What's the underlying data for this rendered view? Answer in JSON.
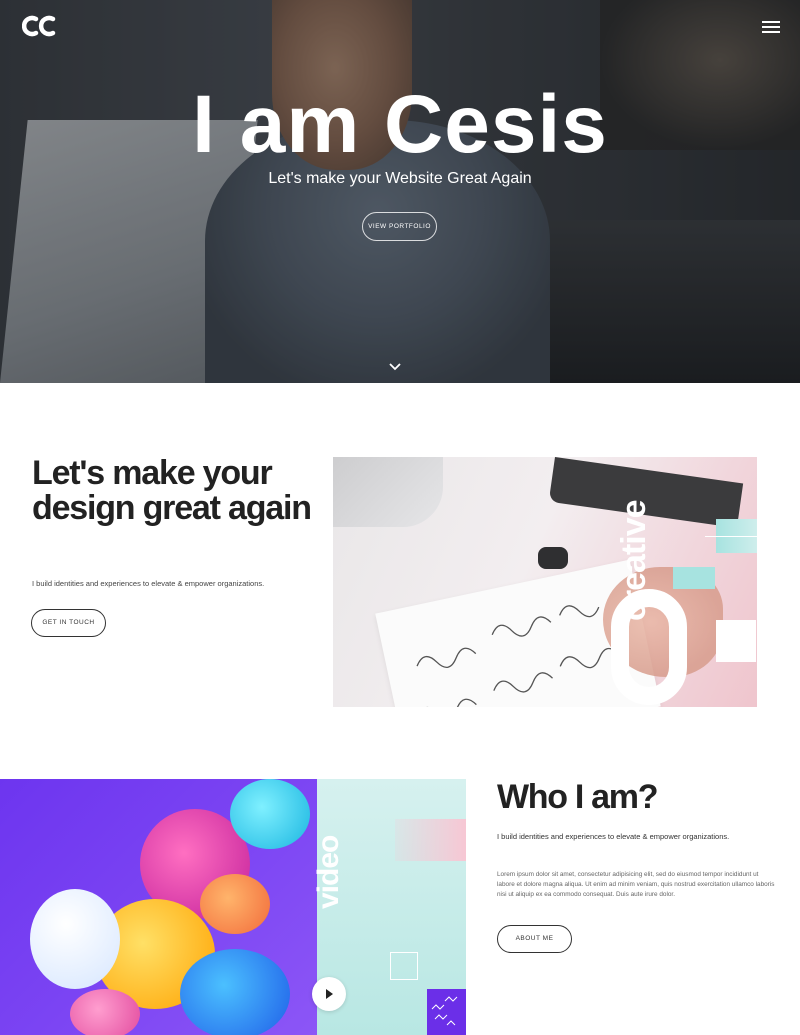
{
  "header": {
    "logo_icon": "cc-logo-icon",
    "menu_icon": "hamburger-menu-icon"
  },
  "hero": {
    "title": "I am Cesis",
    "subtitle": "Let's make your Website Great Again",
    "button_label": "VIEW PORTFOLIO",
    "scroll_icon": "chevron-down-icon"
  },
  "intro": {
    "title": "Let's make your design great again",
    "text": "I build identities and experiences to elevate & empower organizations.",
    "button_label": "GET IN TOUCH",
    "image_word": "creative"
  },
  "about": {
    "title": "Who I am?",
    "lead": "I build identities and experiences to elevate & empower organizations.",
    "body": "Lorem ipsum dolor sit amet, consectetur adipisicing elit, sed do eiusmod tempor incididunt ut labore et dolore magna aliqua. Ut enim ad minim veniam, quis nostrud exercitation ullamco laboris nisi ut aliquip ex ea commodo consequat. Duis aute irure dolor.",
    "button_label": "ABOUT ME",
    "image_word": "video",
    "play_icon": "play-icon"
  },
  "colors": {
    "accent_purple": "#7a3bf0",
    "accent_mint": "#a7e3e0",
    "accent_pink": "#f7c7d4"
  }
}
